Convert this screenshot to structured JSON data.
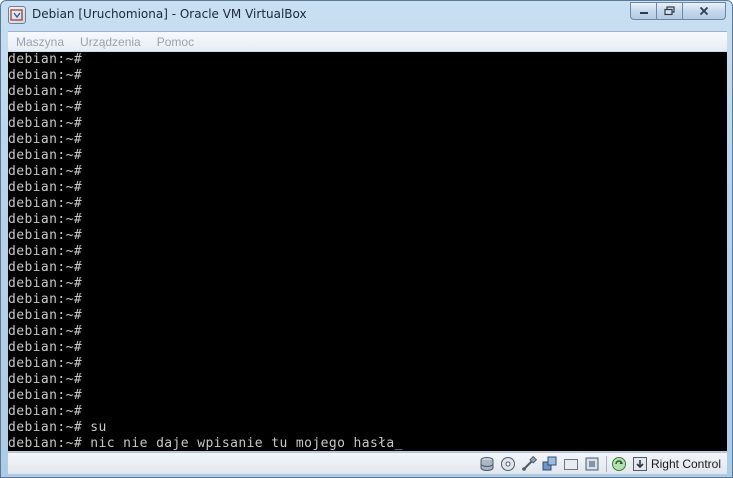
{
  "window": {
    "title": "Debian [Uruchomiona] - Oracle VM VirtualBox"
  },
  "menu": {
    "items": [
      "Maszyna",
      "Urządzenia",
      "Pomoc"
    ]
  },
  "terminal": {
    "lines": [
      "debian:~#",
      "debian:~#",
      "debian:~#",
      "debian:~#",
      "debian:~#",
      "debian:~#",
      "debian:~#",
      "debian:~#",
      "debian:~#",
      "debian:~#",
      "debian:~#",
      "debian:~#",
      "debian:~#",
      "debian:~#",
      "debian:~#",
      "debian:~#",
      "debian:~#",
      "debian:~#",
      "debian:~#",
      "debian:~#",
      "debian:~#",
      "debian:~#",
      "debian:~#",
      "debian:~# su",
      "debian:~# nic nie daje wpisanie tu mojego hasła_"
    ]
  },
  "statusbar": {
    "host_key": "Right Control",
    "icons": [
      "hard-disk-icon",
      "optical-drive-icon",
      "usb-icon",
      "network-icon",
      "shared-folders-icon",
      "capture-icon",
      "mouse-integration-icon",
      "keyboard-capture-icon"
    ]
  }
}
